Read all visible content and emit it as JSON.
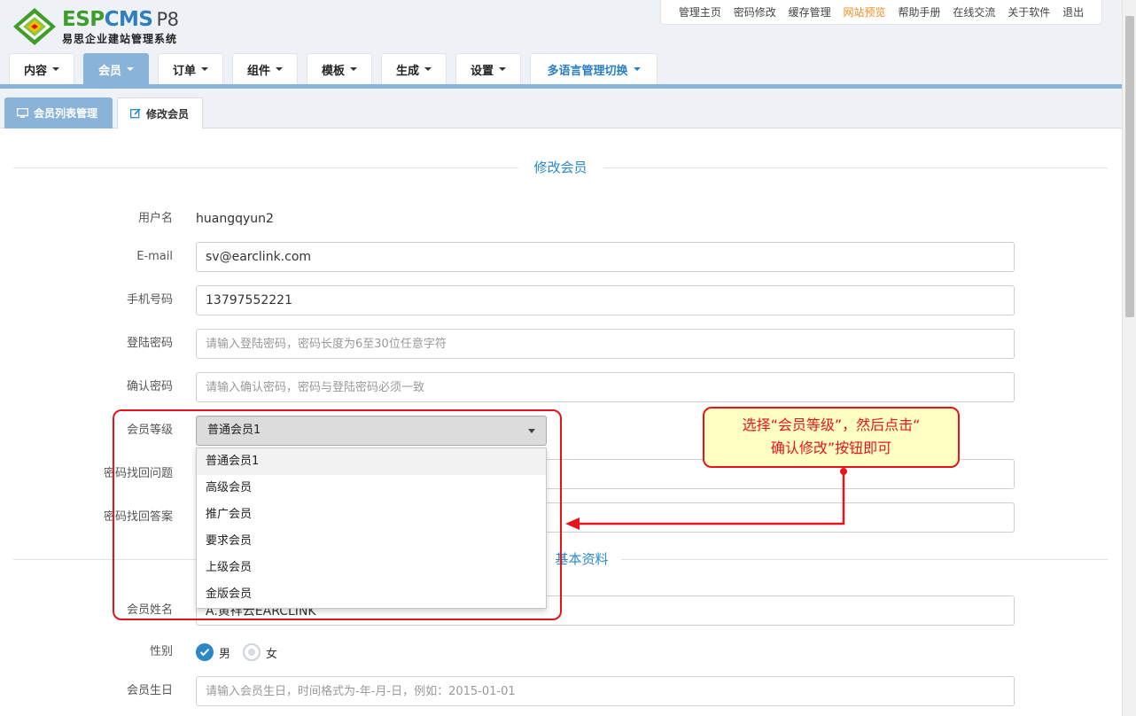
{
  "logo": {
    "brand_a": "ESP",
    "brand_b": "CMS",
    "version": "P8",
    "subtitle": "易思企业建站管理系统"
  },
  "topnav": [
    {
      "label": "管理主页",
      "highlight": false
    },
    {
      "label": "密码修改",
      "highlight": false
    },
    {
      "label": "缓存管理",
      "highlight": false
    },
    {
      "label": "网站预览",
      "highlight": true
    },
    {
      "label": "帮助手册",
      "highlight": false
    },
    {
      "label": "在线交流",
      "highlight": false
    },
    {
      "label": "关于软件",
      "highlight": false
    },
    {
      "label": "退出",
      "highlight": false
    }
  ],
  "mainnav": [
    {
      "label": "内容"
    },
    {
      "label": "会员",
      "active": true
    },
    {
      "label": "订单"
    },
    {
      "label": "组件"
    },
    {
      "label": "模板"
    },
    {
      "label": "生成"
    },
    {
      "label": "设置"
    },
    {
      "label": "多语言管理切换",
      "lang": true
    }
  ],
  "subtabs": {
    "list": "会员列表管理",
    "edit": "修改会员"
  },
  "section1": {
    "title": "修改会员"
  },
  "section2": {
    "title": "基本资料"
  },
  "form": {
    "username": {
      "label": "用户名",
      "value": "huangqyun2"
    },
    "email": {
      "label": "E-mail",
      "value": "sv@earclink.com"
    },
    "mobile": {
      "label": "手机号码",
      "value": "13797552221"
    },
    "password": {
      "label": "登陆密码",
      "placeholder": "请输入登陆密码，密码长度为6至30位任意字符"
    },
    "confirm": {
      "label": "确认密码",
      "placeholder": "请输入确认密码，密码与登陆密码必须一致"
    },
    "level": {
      "label": "会员等级",
      "selected": "普通会员1",
      "options": [
        "普通会员1",
        "高级会员",
        "推广会员",
        "要求会员",
        "上级会员",
        "金版会员"
      ]
    },
    "question": {
      "label": "密码找回问题",
      "value": ""
    },
    "answer": {
      "label": "密码找回答案",
      "value": ""
    },
    "realname": {
      "label": "会员姓名",
      "value": "A.黄祥云EARCLINK"
    },
    "gender": {
      "label": "性别",
      "male": "男",
      "female": "女"
    },
    "birthday": {
      "label": "会员生日",
      "placeholder": "请输入会员生日，时间格式为-年-月-日，例如：2015-01-01"
    }
  },
  "annotation": {
    "line1": "选择“会员等级”，然后点击“",
    "line2": "确认修改”按钮即可"
  },
  "colors": {
    "accent": "#2a88c8",
    "nav_active": "#8ab3d9",
    "highlight": "#f08b1f",
    "annotation": "#e8141b",
    "callout_bg": "#ffffc4"
  }
}
